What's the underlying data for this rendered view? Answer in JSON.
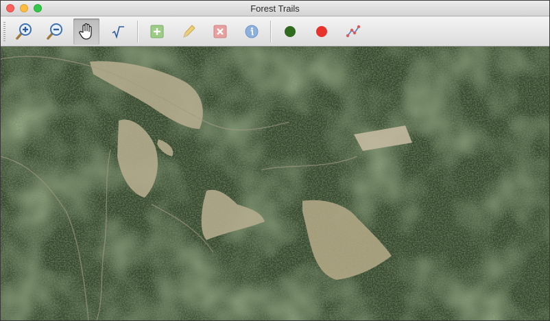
{
  "window": {
    "title": "Forest Trails"
  },
  "toolbar": {
    "tools": [
      {
        "name": "zoom-in-icon",
        "active": false
      },
      {
        "name": "zoom-out-icon",
        "active": false
      },
      {
        "name": "pan-hand-icon",
        "active": true
      },
      {
        "name": "sqrt-measure-icon",
        "active": false
      },
      {
        "name": "add-feature-icon",
        "active": false,
        "enabled": false
      },
      {
        "name": "edit-pencil-icon",
        "active": false,
        "enabled": false
      },
      {
        "name": "delete-feature-icon",
        "active": false,
        "enabled": false
      },
      {
        "name": "info-icon",
        "active": false,
        "enabled": false
      },
      {
        "name": "green-circle-icon",
        "active": false
      },
      {
        "name": "red-circle-icon",
        "active": false
      },
      {
        "name": "line-tool-icon",
        "active": false
      }
    ]
  },
  "colors": {
    "forest_dark": "#2b3a22",
    "forest_mid": "#3d5030",
    "clearing": "#b7ae92",
    "green_marker": "#2e6b1e",
    "red_marker": "#e8322c"
  }
}
